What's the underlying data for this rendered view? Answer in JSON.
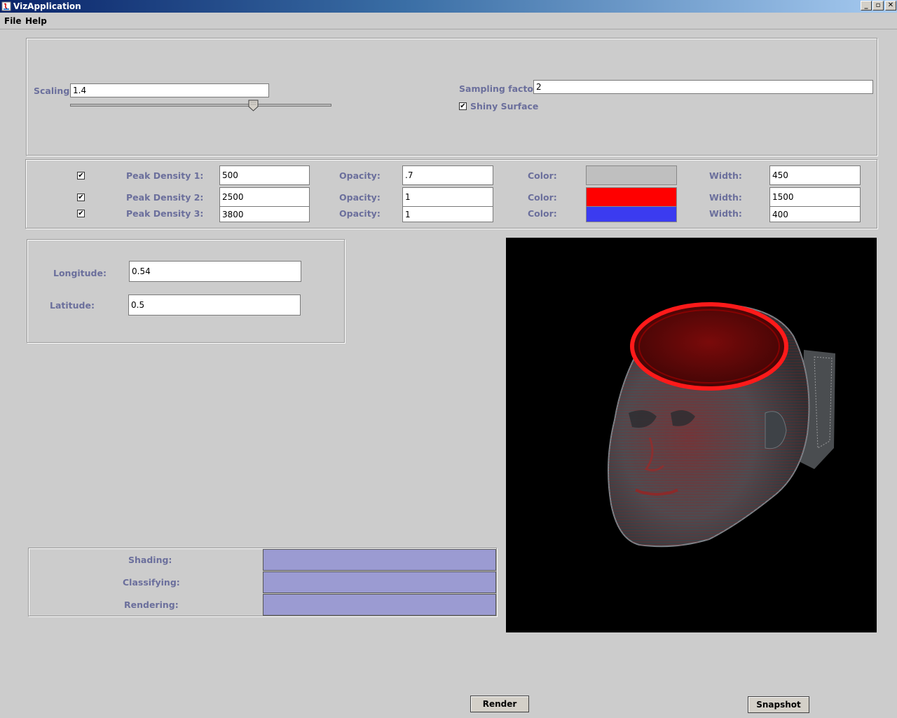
{
  "window": {
    "title": "VizApplication",
    "controls": [
      "minimize-icon",
      "restore-icon",
      "close-icon"
    ]
  },
  "menu": [
    "File",
    "Help"
  ],
  "settings": {
    "scaling_label": "Scaling:",
    "scaling_value": "1.4",
    "scaling_slider_fraction": 0.7,
    "sampling_label": "Sampling factor:",
    "sampling_value": "2",
    "shiny_label": "Shiny Surface",
    "shiny_checked": true
  },
  "peaks": [
    {
      "label": "Peak Density 1:",
      "density": "500",
      "opacity_label": "Opacity:",
      "opacity": ".7",
      "color_label": "Color:",
      "color": "#bfbfbf",
      "width_label": "Width:",
      "width": "450",
      "enabled": true
    },
    {
      "label": "Peak Density 2:",
      "density": "2500",
      "opacity_label": "Opacity:",
      "opacity": "1",
      "color_label": "Color:",
      "color": "#ff0000",
      "width_label": "Width:",
      "width": "1500",
      "enabled": true
    },
    {
      "label": "Peak Density 3:",
      "density": "3800",
      "opacity_label": "Opacity:",
      "opacity": "1",
      "color_label": "Color:",
      "color": "#3b3bf0",
      "width_label": "Width:",
      "width": "400",
      "enabled": true
    }
  ],
  "view": {
    "longitude_label": "Longitude:",
    "longitude_value": "0.54",
    "latitude_label": "Latitude:",
    "latitude_value": "0.5"
  },
  "progress": {
    "shading_label": "Shading:",
    "classifying_label": "Classifying:",
    "rendering_label": "Rendering:",
    "color": "#9b9bd2"
  },
  "buttons": {
    "render": "Render",
    "snapshot": "Snapshot"
  },
  "rendered_image": "volume-rendered-head"
}
